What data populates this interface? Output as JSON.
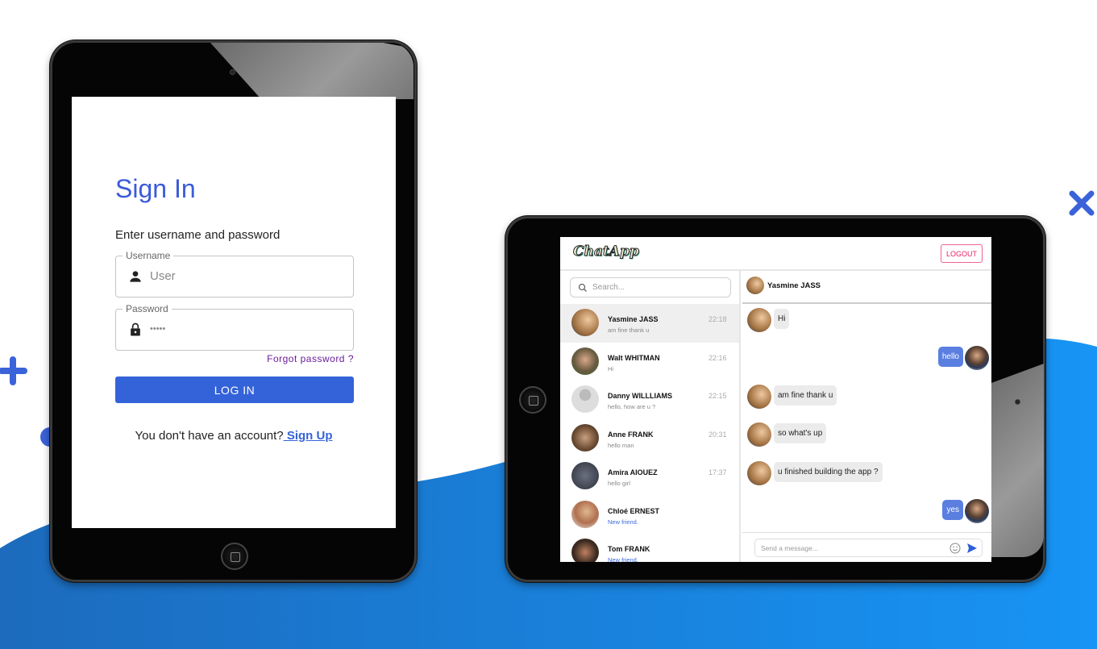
{
  "colors": {
    "accent": "#3462d9",
    "background_wave": "#1a82e0",
    "logout": "#e91e63"
  },
  "login": {
    "title": "Sign In",
    "subtitle": "Enter username and password",
    "username": {
      "label": "Username",
      "placeholder": "User",
      "icon": "person-icon"
    },
    "password": {
      "label": "Password",
      "value": "•••••",
      "icon": "lock-icon"
    },
    "forgot": "Forgot password ?",
    "login_button": "LOG IN",
    "no_account": "You don't have an account?",
    "signup": " Sign Up"
  },
  "chat": {
    "logo": "ChatApp",
    "logout": "LOGOUT",
    "search_placeholder": "Search...",
    "contacts": [
      {
        "name": "Yasmine JASS",
        "message": "am fine thank u",
        "time": "22:18"
      },
      {
        "name": "Walt WHITMAN",
        "message": "Hi",
        "time": "22:16"
      },
      {
        "name": "Danny WILLLIAMS",
        "message": "hello, how are u ?",
        "time": "22:15"
      },
      {
        "name": "Anne FRANK",
        "message": "hello man",
        "time": "20:31"
      },
      {
        "name": "Amira AIOUEZ",
        "message": "hello girl",
        "time": "17:37"
      },
      {
        "name": "Chloé ERNEST",
        "message": "New friend.",
        "time": ""
      },
      {
        "name": "Tom FRANK",
        "message": "New friend.",
        "time": ""
      }
    ],
    "active_contact": "Yasmine JASS",
    "messages": [
      {
        "text": "Hi",
        "from": "them"
      },
      {
        "text": "hello",
        "from": "me"
      },
      {
        "text": "am fine thank u",
        "from": "them"
      },
      {
        "text": "so what's up",
        "from": "them"
      },
      {
        "text": "u finished building the app ?",
        "from": "them"
      },
      {
        "text": "yes",
        "from": "me"
      }
    ],
    "input_placeholder": "Send a message..."
  }
}
